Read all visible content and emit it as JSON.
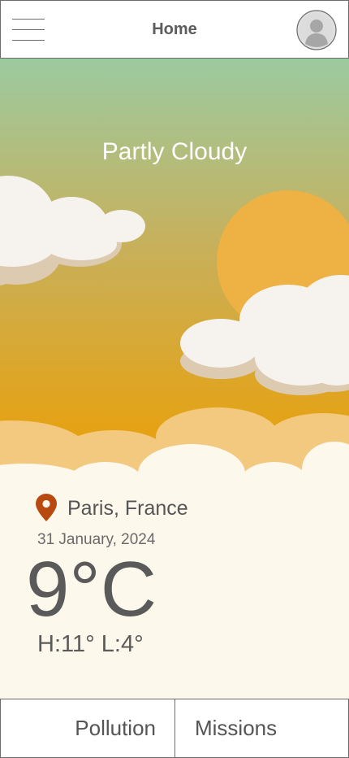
{
  "header": {
    "title": "Home",
    "menu_icon": "hamburger-menu-icon",
    "avatar_icon": "user-avatar-icon"
  },
  "weather": {
    "condition": "Partly Cloudy",
    "location": "Paris, France",
    "date": "31 January, 2024",
    "temperature": "9°C",
    "high_low": "H:11° L:4°",
    "location_icon": "location-pin-icon"
  },
  "bottom_nav": {
    "pollution_label": "Pollution",
    "missions_label": "Missions"
  },
  "colors": {
    "sky_top": "#9ccaa0",
    "sky_bottom": "#e5a214",
    "sun": "#eeb244",
    "cloud": "#f6f3ee",
    "cloud_shadow": "#dccab1",
    "panel_bg": "#fdf8ec",
    "pin": "#b84a10",
    "text": "#5a5a5a"
  }
}
